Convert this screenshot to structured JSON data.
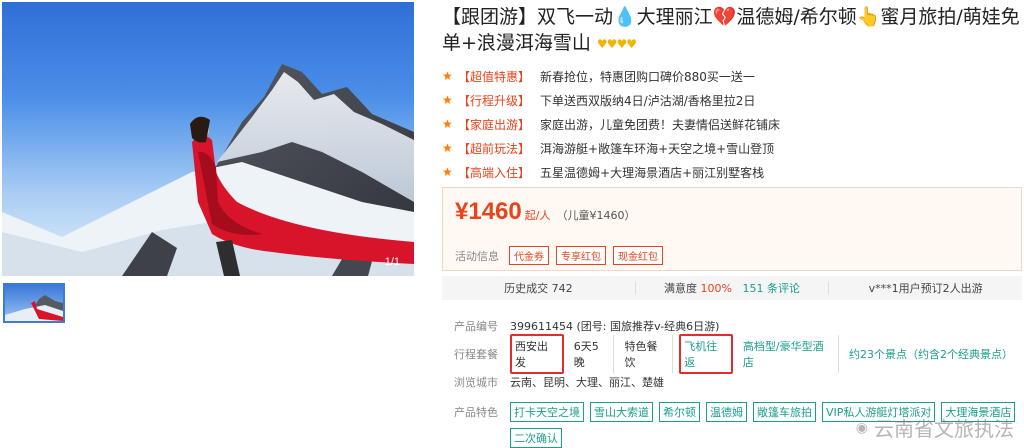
{
  "gallery": {
    "counter": "1/1"
  },
  "title": "【跟团游】双飞一动💧大理丽江💔温德姆/希尔顿👆蜜月旅拍/萌娃免单+浪漫洱海雪山",
  "rating_stars": "♥♥♥♥",
  "features": [
    {
      "tag": "【超值特惠】",
      "text": "新春抢位，特惠团购口碑价880买一送一"
    },
    {
      "tag": "【行程升级】",
      "text": "下单送西双版纳4日/泸沽湖/香格里拉2日"
    },
    {
      "tag": "【家庭出游】",
      "text": "家庭出游，儿童免团费！夫妻情侣送鲜花铺床"
    },
    {
      "tag": "【超前玩法】",
      "text": "洱海游艇+敞篷车环海+天空之境+雪山登顶"
    },
    {
      "tag": "【高端入住】",
      "text": "五星温德姆+大理海景酒店+丽江别墅客栈"
    }
  ],
  "price": {
    "amount": "¥1460",
    "unit": "起/人",
    "child": "（儿童¥1460）"
  },
  "activity": {
    "label": "活动信息",
    "coupons": [
      "代金券",
      "专享红包",
      "现金红包"
    ]
  },
  "stats": {
    "history_label": "历史成交 742",
    "satisfaction_label": "满意度 ",
    "satisfaction_value": "100%",
    "reviews": "151 条评论",
    "recent": "v***1用户预订2人出游"
  },
  "info": {
    "product_no_label": "产品编号",
    "product_no": "399611454 (团号: 国旅推荐v-经典6日游)",
    "package_label": "行程套餐",
    "packages": [
      "西安出发",
      "6天5晚",
      "特色餐饮",
      "飞机往返",
      "高档型/豪华型酒店",
      "约23个景点（约含2个经典景点）"
    ],
    "cities_label": "浏览城市",
    "cities": "云南、昆明、大理、丽江、楚雄",
    "features_label": "产品特色",
    "feature_tags": [
      "打卡天空之境",
      "雪山大索道",
      "希尔顿",
      "温德姆",
      "敞篷车旅拍",
      "VIP私人游艇灯塔派对",
      "大理海景酒店",
      "二次确认"
    ]
  },
  "watermark": "云南省文旅执法"
}
